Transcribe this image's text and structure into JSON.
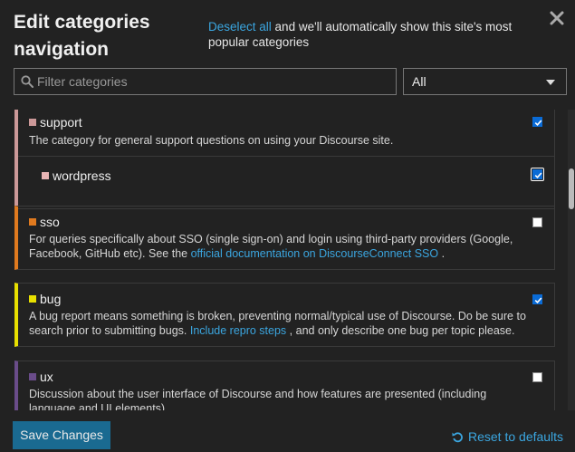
{
  "header": {
    "title": "Edit categories navigation",
    "deselect_link": "Deselect all",
    "intro_rest": "and we'll automatically show this site's most popular categories",
    "close_icon": "close-icon"
  },
  "filter": {
    "placeholder": "Filter categories",
    "value": ""
  },
  "select": {
    "value": "All"
  },
  "categories": [
    {
      "name": "support",
      "color": "#cc9999",
      "description": "The category for general support questions on using your Discourse site.",
      "checked": true
    },
    {
      "name": "wordpress",
      "color": "#e8b4b4",
      "checked": true
    },
    {
      "name": "sso",
      "color": "#e07a1f",
      "description": "For queries specifically about SSO (single sign-on) and login using third-party providers (Google, Facebook, GitHub etc). See the",
      "link": "official documentation on DiscourseConnect SSO",
      "description_after": ".",
      "checked": false
    },
    {
      "name": "bug",
      "color": "#e8e000",
      "description": "A bug report means something is broken, preventing normal/typical use of Discourse. Do be sure to search prior to submitting bugs.",
      "link": "Include repro steps",
      "description_after": ", and only describe one bug per topic please.",
      "checked": true
    },
    {
      "name": "ux",
      "color": "#6a4c8a",
      "description": "Discussion about the user interface of Discourse and how features are presented (including language and UI elements)",
      "checked": false
    }
  ],
  "footer": {
    "save_label": "Save Changes",
    "reset_label": "Reset to defaults"
  }
}
